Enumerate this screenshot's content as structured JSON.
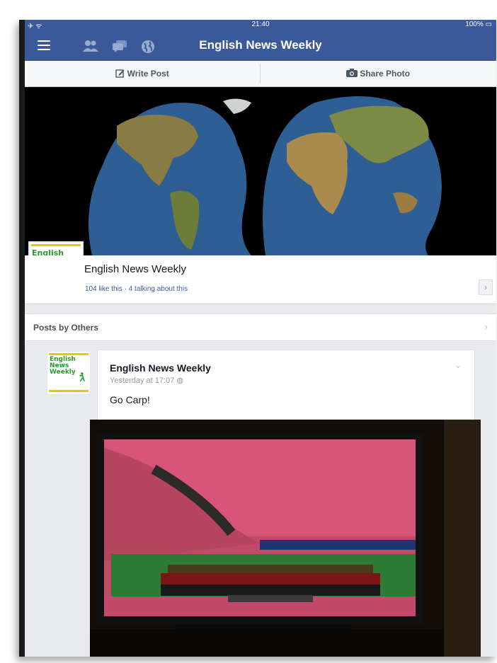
{
  "status_bar": {
    "time": "21:40",
    "left_icons": "✈ ᯤ",
    "battery": "100%"
  },
  "nav": {
    "title": "English News Weekly",
    "icons": [
      "menu-icon",
      "friends-icon",
      "messages-icon",
      "notifications-globe-icon"
    ]
  },
  "actions": {
    "write_post": "Write Post",
    "share_photo": "Share Photo"
  },
  "page": {
    "name": "English News Weekly",
    "stats": "104 like this · 4 talking about this",
    "logo_text": [
      "English",
      "News",
      "Weekly"
    ]
  },
  "posts_by_others": {
    "label": "Posts by Others"
  },
  "post": {
    "author": "English News Weekly",
    "time": "Yesterday at 17:07",
    "text": "Go Carp!"
  },
  "colors": {
    "brand": "#3b5998",
    "background": "#e9eaed"
  }
}
